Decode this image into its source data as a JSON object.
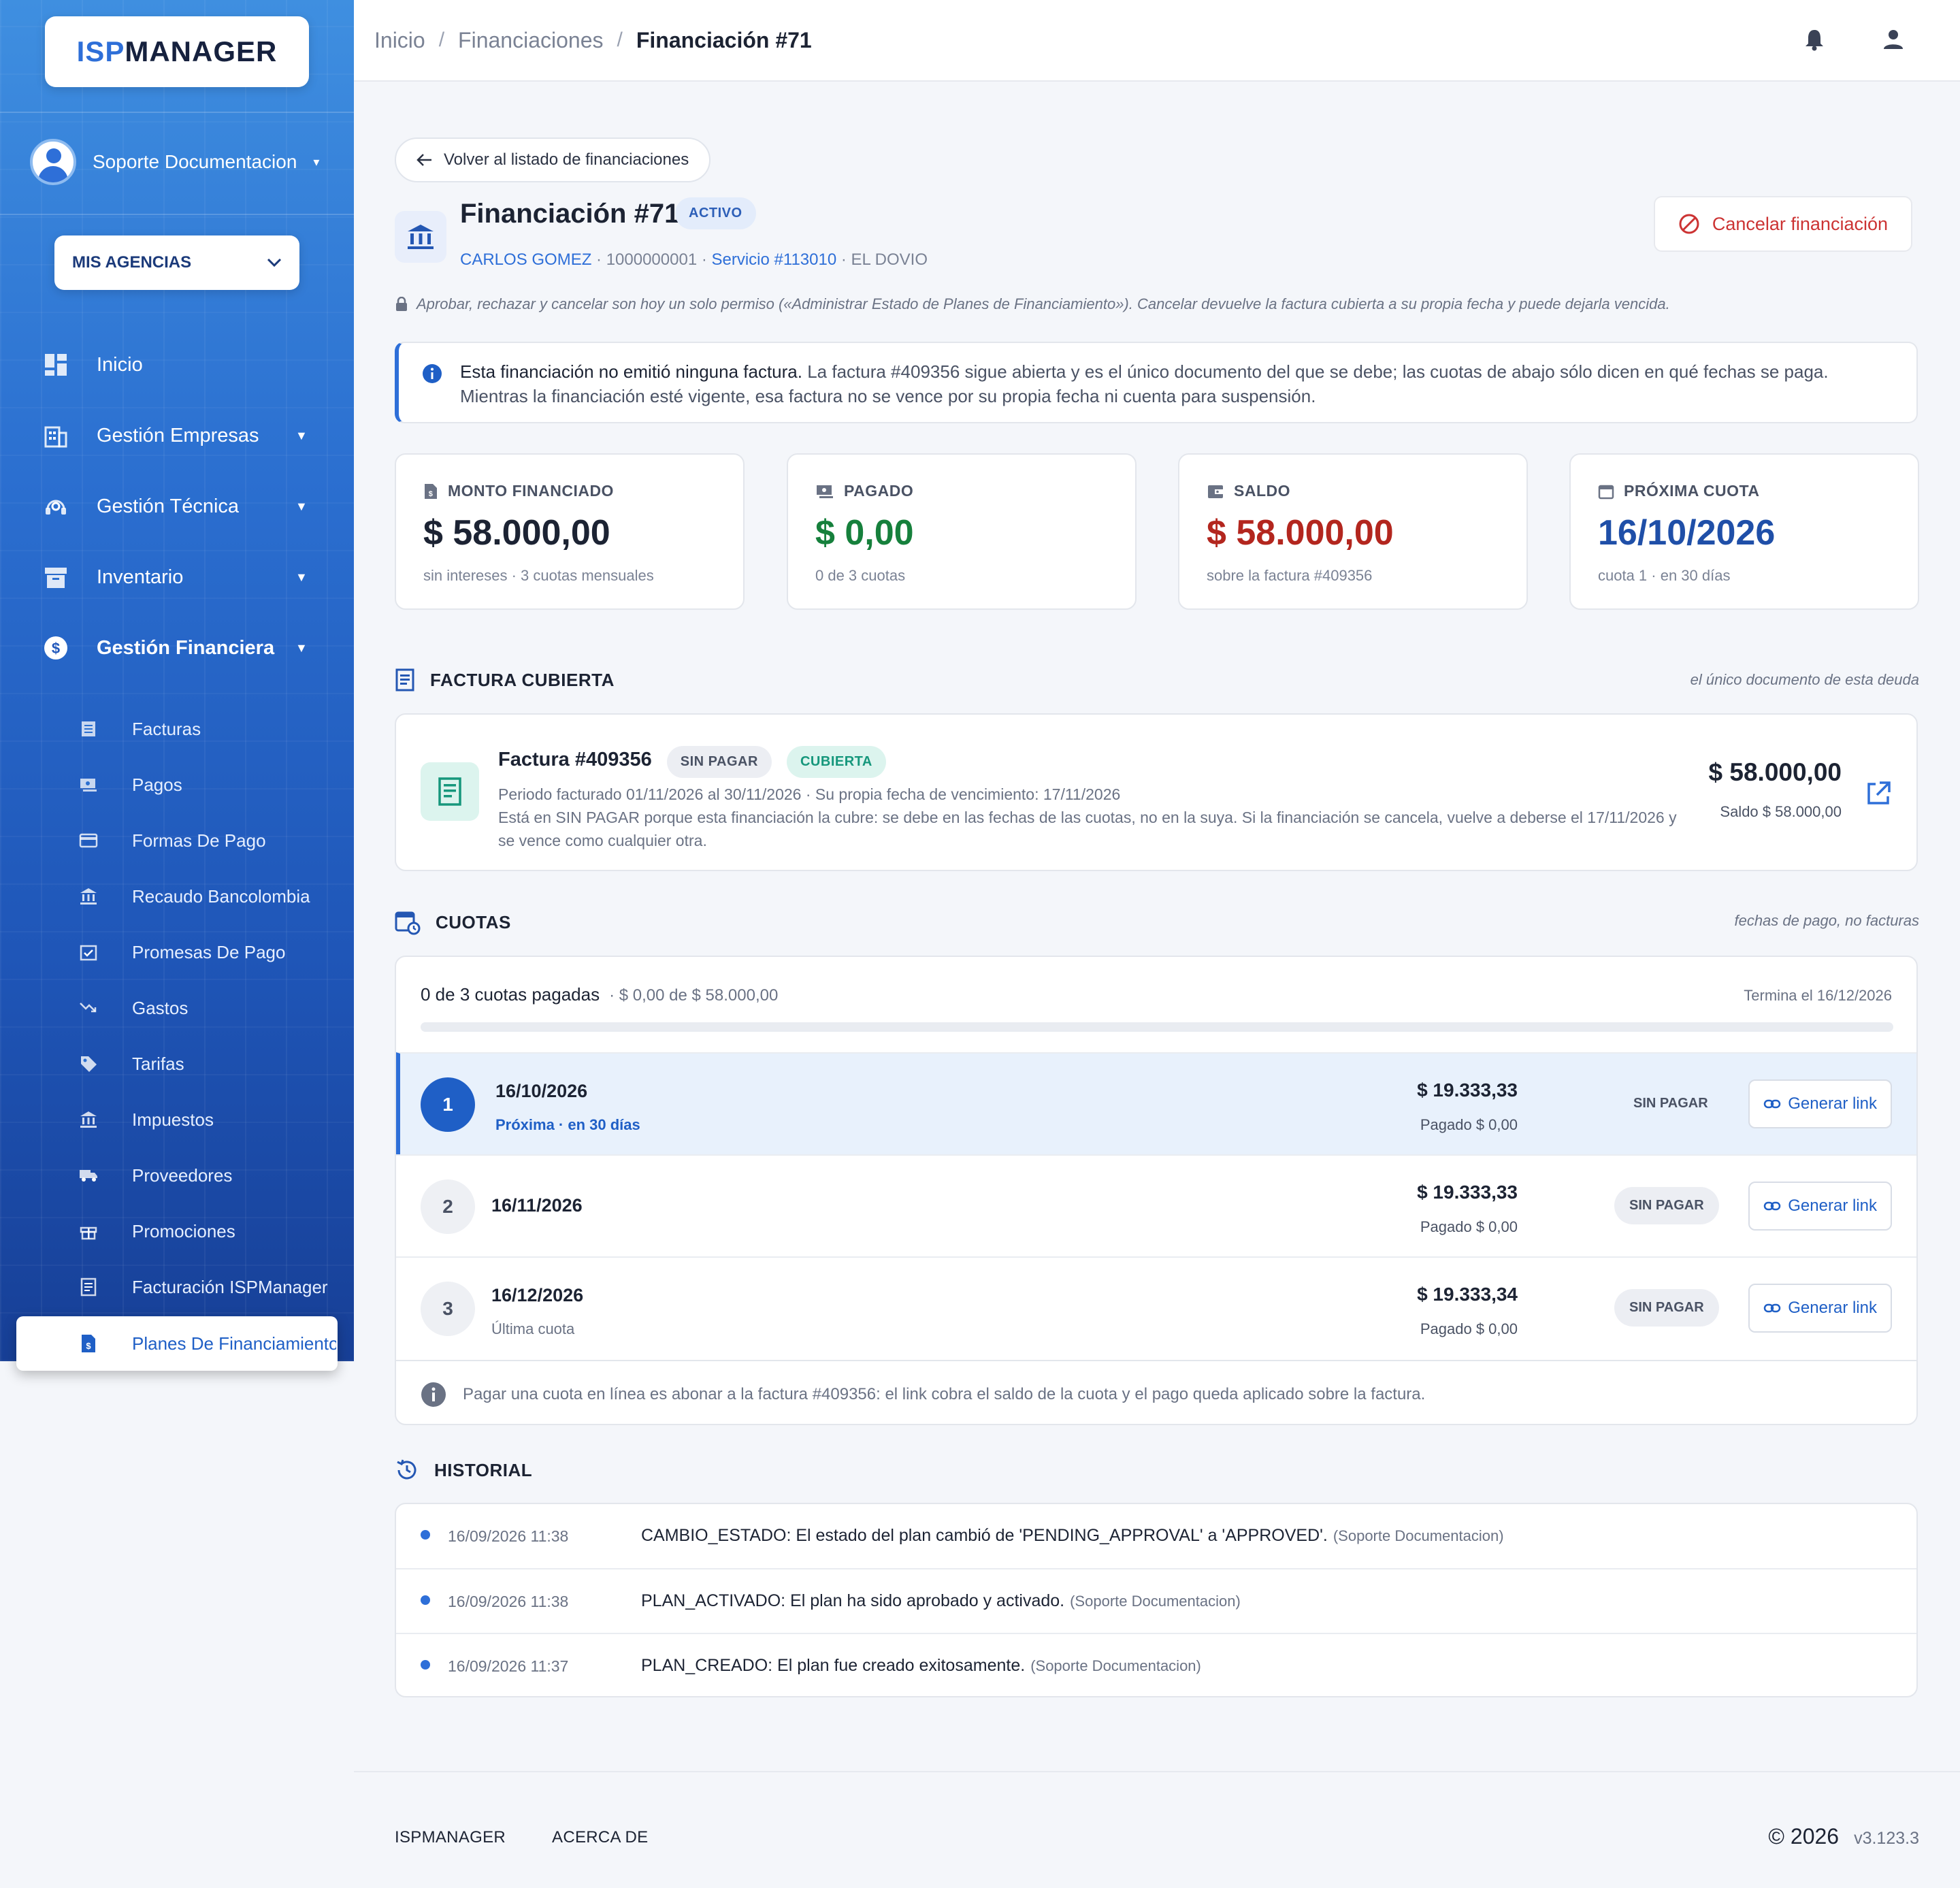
{
  "brand": {
    "isp": "ISP",
    "manager": "MANAGER"
  },
  "user": {
    "name": "Soporte Documentacion"
  },
  "agency_button": "MIS AGENCIAS",
  "nav": {
    "inicio": "Inicio",
    "empresas": "Gestión Empresas",
    "tecnica": "Gestión Técnica",
    "inventario": "Inventario",
    "financiera": "Gestión Financiera",
    "sub": [
      "Facturas",
      "Pagos",
      "Formas De Pago",
      "Recaudo Bancolombia",
      "Promesas De Pago",
      "Gastos",
      "Tarifas",
      "Impuestos",
      "Proveedores",
      "Promociones",
      "Facturación ISPManager",
      "Planes De Financiamiento"
    ]
  },
  "breadcrumb": {
    "home": "Inicio",
    "section": "Financiaciones",
    "current": "Financiación #71",
    "sep": "/"
  },
  "back_label": "Volver al listado de financiaciones",
  "header": {
    "title": "Financiación #71",
    "status": "ACTIVO",
    "client": "CARLOS GOMEZ",
    "client_id": " · 1000000001 · ",
    "service": "Servicio #113010",
    "location": " · EL DOVIO",
    "cancel_label": "Cancelar financiación"
  },
  "permission_note": "Aprobar, rechazar y cancelar son hoy un solo permiso («Administrar Estado de Planes de Financiamiento»). Cancelar devuelve la factura cubierta a su propia fecha y puede dejarla vencida.",
  "info": {
    "strong": "Esta financiación no emitió ninguna factura.",
    "text": " La factura #409356 sigue abierta y es el único documento del que se debe; las cuotas de abajo sólo dicen en qué fechas se paga. Mientras la financiación esté vigente, esa factura no se vence por su propia fecha ni cuenta para suspensión."
  },
  "stats": [
    {
      "label": "MONTO FINANCIADO",
      "value": "$ 58.000,00",
      "sub": "sin intereses · 3 cuotas mensuales",
      "color": "#1c2333"
    },
    {
      "label": "PAGADO",
      "value": "$ 0,00",
      "sub": "0 de 3 cuotas",
      "color": "#16803c"
    },
    {
      "label": "SALDO",
      "value": "$ 58.000,00",
      "sub": "sobre la factura #409356",
      "color": "#b3261e"
    },
    {
      "label": "PRÓXIMA CUOTA",
      "value": "16/10/2026",
      "sub": "cuota 1 · en 30 días",
      "color": "#1f4fa8"
    }
  ],
  "invoice_section": {
    "title": "FACTURA CUBIERTA",
    "right": "el único documento de esta deuda"
  },
  "invoice": {
    "title": "Factura #409356",
    "badge1": "SIN PAGAR",
    "badge2": "CUBIERTA",
    "line1": "Periodo facturado 01/11/2026 al 30/11/2026 · Su propia fecha de vencimiento: 17/11/2026",
    "line2": "Está en SIN PAGAR porque esta financiación la cubre: se debe en las fechas de las cuotas, no en la suya. Si la financiación se cancela, vuelve a deberse el 17/11/2026 y se vence como cualquier otra.",
    "amount": "$ 58.000,00",
    "balance": "Saldo $ 58.000,00"
  },
  "cuotas_section": {
    "title": "CUOTAS",
    "right": "fechas de pago, no facturas"
  },
  "progress": {
    "label": "0 de 3 cuotas pagadas",
    "detail": "· $ 0,00 de $ 58.000,00",
    "ends": "Termina el 16/12/2026",
    "paid_fraction": 0
  },
  "cuotas": [
    {
      "n": "1",
      "date": "16/10/2026",
      "sub": "Próxima · en 30 días",
      "amount": "$ 19.333,33",
      "paid": "Pagado $ 0,00",
      "status": "SIN PAGAR",
      "action": "Generar link"
    },
    {
      "n": "2",
      "date": "16/11/2026",
      "sub": "",
      "amount": "$ 19.333,33",
      "paid": "Pagado $ 0,00",
      "status": "SIN PAGAR",
      "action": "Generar link"
    },
    {
      "n": "3",
      "date": "16/12/2026",
      "sub": "Última cuota",
      "amount": "$ 19.333,34",
      "paid": "Pagado $ 0,00",
      "status": "SIN PAGAR",
      "action": "Generar link"
    }
  ],
  "cuotas_note": "Pagar una cuota en línea es abonar a la factura #409356: el link cobra el saldo de la cuota y el pago queda aplicado sobre la factura.",
  "history_section": {
    "title": "HISTORIAL"
  },
  "history": [
    {
      "date": "16/09/2026 11:38",
      "text": "CAMBIO_ESTADO: El estado del plan cambió de 'PENDING_APPROVAL' a 'APPROVED'.",
      "user": "(Soporte Documentacion)"
    },
    {
      "date": "16/09/2026 11:38",
      "text": "PLAN_ACTIVADO: El plan ha sido aprobado y activado.",
      "user": "(Soporte Documentacion)"
    },
    {
      "date": "16/09/2026 11:37",
      "text": "PLAN_CREADO: El plan fue creado exitosamente.",
      "user": "(Soporte Documentacion)"
    }
  ],
  "footer": {
    "link1": "ISPMANAGER",
    "link2": "ACERCA DE",
    "copyright": "© 2026",
    "version": "v3.123.3"
  },
  "colors": {
    "primary": "#2e6fd8",
    "danger": "#b3261e",
    "success": "#16803c",
    "teal": "#16977c"
  }
}
